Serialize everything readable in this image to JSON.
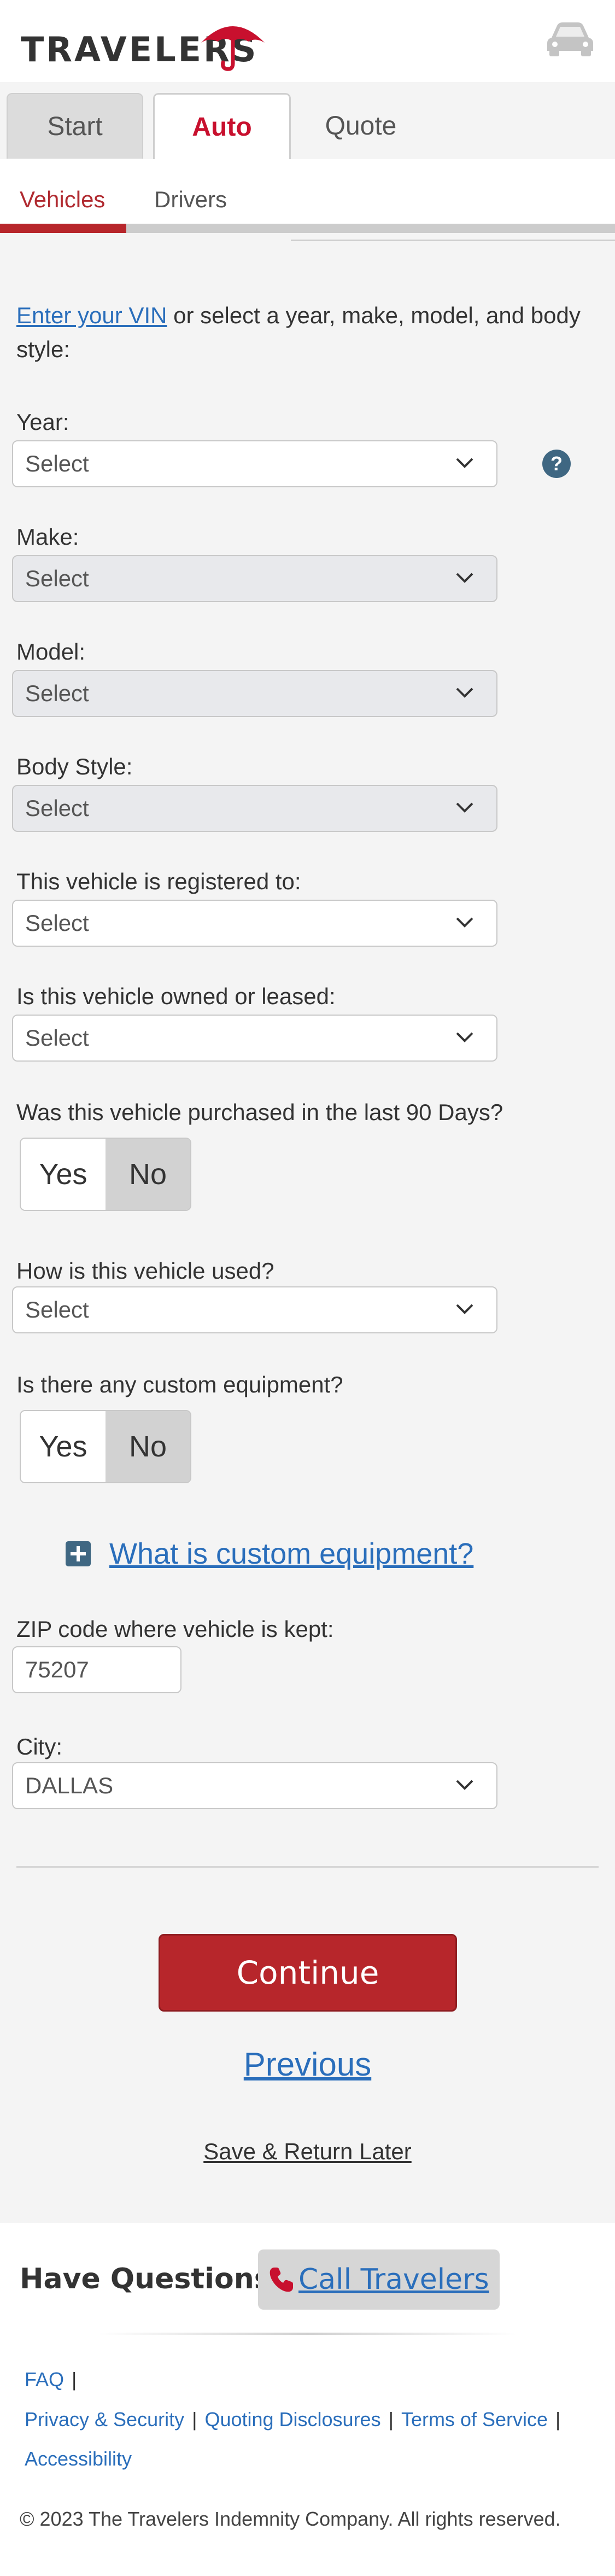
{
  "header": {
    "logo_text": "TRAVELERS",
    "colors": {
      "brand_red": "#c8102e",
      "link_blue": "#2a6ebb"
    },
    "icons": {
      "logo": "umbrella-icon",
      "vehicle": "car-icon"
    }
  },
  "tabs": [
    {
      "label": "Start"
    },
    {
      "label": "Auto"
    },
    {
      "label": "Quote"
    }
  ],
  "subtabs": [
    {
      "label": "Vehicles"
    },
    {
      "label": "Drivers"
    }
  ],
  "progress_fraction": 0.205,
  "form": {
    "intro_link": "Enter your VIN",
    "intro_rest": " or select a year, make, model, and body style:",
    "year_label": "Year:",
    "year_value": "Select",
    "make_label": "Make:",
    "make_value": "Select",
    "model_label": "Model:",
    "model_value": "Select",
    "body_label": "Body Style:",
    "body_value": "Select",
    "registered_label": "This vehicle is registered to:",
    "registered_value": "Select",
    "owned_label": "Is this vehicle owned or leased:",
    "owned_value": "Select",
    "purchased_label": "Was this vehicle purchased in the last 90 Days?",
    "purchased_yes": "Yes",
    "purchased_no": "No",
    "used_label": "How is this vehicle used?",
    "used_value": "Select",
    "custom_label": "Is there any custom equipment?",
    "custom_yes": "Yes",
    "custom_no": "No",
    "custom_link": "What is custom equipment?",
    "zip_label": "ZIP code where vehicle is kept:",
    "zip_value": "75207",
    "city_label": "City:",
    "city_value": "DALLAS"
  },
  "actions": {
    "continue": "Continue",
    "previous": "Previous",
    "save_return": "Save & Return Later"
  },
  "footer": {
    "questions": "Have Questions?",
    "call": "Call Travelers",
    "faq": "FAQ",
    "privacy": "Privacy & Security",
    "disclosures": "Quoting Disclosures",
    "terms": "Terms of Service",
    "accessibility": "Accessibility",
    "copyright": "© 2023 The Travelers Indemnity Company. All rights reserved."
  }
}
